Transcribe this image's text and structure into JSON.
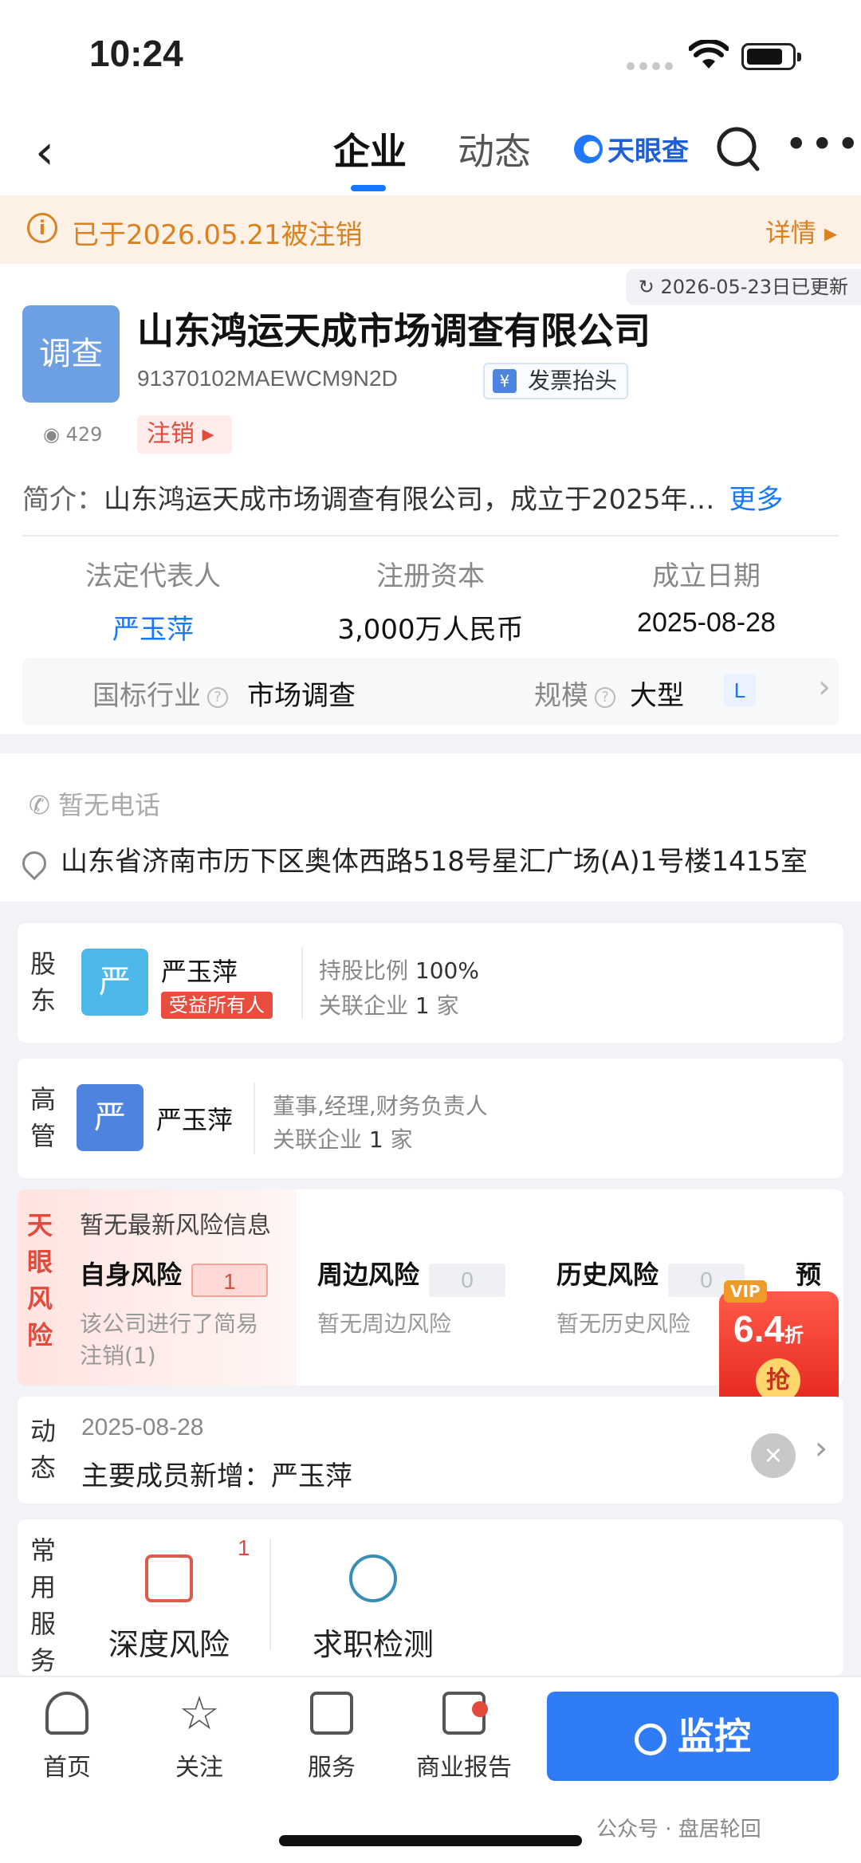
{
  "status_bar": {
    "time": "10:24"
  },
  "nav": {
    "tabs": [
      {
        "label": "企业"
      },
      {
        "label": "动态"
      }
    ],
    "brand": "天眼查"
  },
  "banner": {
    "text": "已于2026.05.21被注销",
    "detail": "详情"
  },
  "company": {
    "updated": "2026-05-23日已更新",
    "avatar_text": "调查",
    "name": "山东鸿运天成市场调查有限公司",
    "credit_code": "91370102MAEWCM9N2D",
    "invoice_label": "发票抬头",
    "views": "429",
    "status": "注销",
    "intro_label": "简介：",
    "intro": "山东鸿运天成市场调查有限公司，成立于2025年…",
    "more": "更多",
    "legal_rep_label": "法定代表人",
    "legal_rep": "严玉萍",
    "capital_label": "注册资本",
    "capital": "3,000万人民币",
    "founded_label": "成立日期",
    "founded": "2025-08-28",
    "industry_label": "国标行业",
    "industry": "市场调查",
    "scale_label": "规模",
    "scale": "大型",
    "scale_badge": "L"
  },
  "contact": {
    "phone": "暂无电话",
    "address": "山东省济南市历下区奥体西路518号星汇广场(A)1号楼1415室"
  },
  "shareholder": {
    "label": "股东",
    "avatar": "严",
    "name": "严玉萍",
    "tag": "受益所有人",
    "ratio_label": "持股比例",
    "ratio": "100%",
    "related_label": "关联企业",
    "related_count": "1",
    "related_unit": "家"
  },
  "executive": {
    "label": "高管",
    "avatar": "严",
    "name": "严玉萍",
    "roles": "董事,经理,财务负责人",
    "related_label": "关联企业",
    "related_count": "1",
    "related_unit": "家"
  },
  "risk": {
    "label": "天眼风险",
    "title": "暂无最新风险信息",
    "self_name": "自身风险",
    "self_count": "1",
    "self_desc": "该公司进行了简易注销(1)",
    "around_name": "周边风险",
    "around_count": "0",
    "around_desc": "暂无周边风险",
    "history_name": "历史风险",
    "history_count": "0",
    "history_desc": "暂无历史风险",
    "warning_name": "预警"
  },
  "vip": {
    "tag": "VIP",
    "price": "6.4",
    "unit": "折",
    "grab": "抢"
  },
  "news": {
    "label": "动态",
    "date": "2025-08-28",
    "text": "主要成员新增：严玉萍"
  },
  "services": {
    "label": "常用服务",
    "items": [
      {
        "label": "深度风险",
        "count": "1"
      },
      {
        "label": "求职检测"
      }
    ]
  },
  "bottom_bar": {
    "items": [
      {
        "label": "首页"
      },
      {
        "label": "关注"
      },
      {
        "label": "服务"
      },
      {
        "label": "商业报告"
      }
    ],
    "monitor": "监控",
    "watermark": "公众号 · 盘居轮回"
  }
}
